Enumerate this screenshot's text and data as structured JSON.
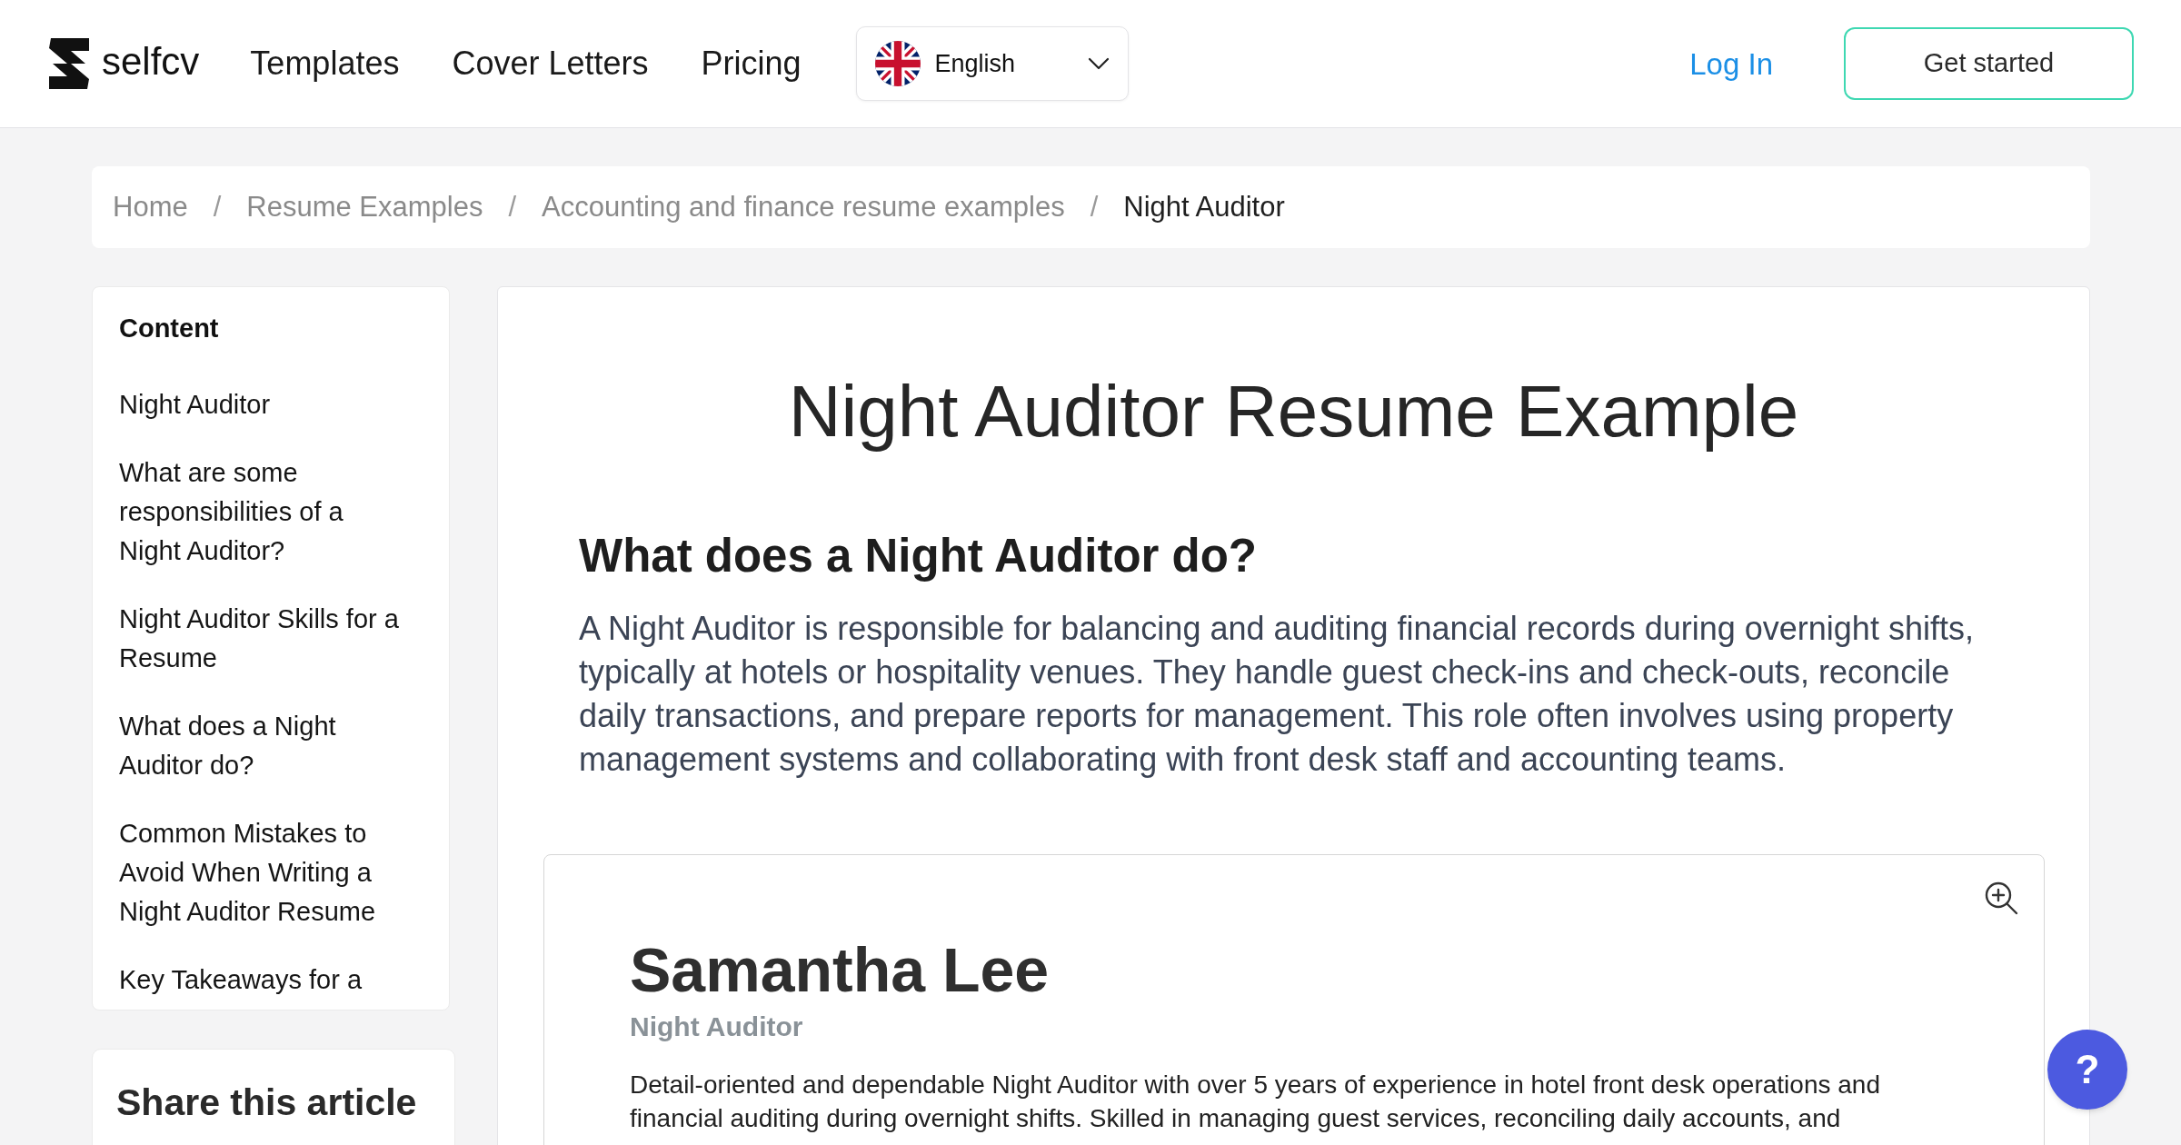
{
  "header": {
    "logo_text": "selfcv",
    "nav": [
      {
        "label": "Templates"
      },
      {
        "label": "Cover Letters"
      },
      {
        "label": "Pricing"
      }
    ],
    "language": {
      "value": "English"
    },
    "login": "Log In",
    "cta": "Get started"
  },
  "breadcrumb": [
    {
      "label": "Home",
      "current": false,
      "separator": "/"
    },
    {
      "label": "Resume Examples",
      "current": false,
      "separator": "/"
    },
    {
      "label": "Accounting and finance resume examples",
      "current": false,
      "separator": "/"
    },
    {
      "label": "Night Auditor",
      "current": true
    }
  ],
  "sidebar": {
    "title": "Content",
    "items": [
      {
        "label": "Night Auditor"
      },
      {
        "label": "What are some responsibilities of a Night Auditor?"
      },
      {
        "label": "Night Auditor Skills for a Resume"
      },
      {
        "label": "What does a Night Auditor do?"
      },
      {
        "label": "Common Mistakes to Avoid When Writing a Night Auditor Resume"
      },
      {
        "label": "Key Takeaways for a"
      }
    ]
  },
  "share": {
    "title": "Share this article"
  },
  "article": {
    "title": "Night Auditor Resume Example",
    "heading": "What does a Night Auditor do?",
    "paragraph": "A Night Auditor is responsible for balancing and auditing financial records during overnight shifts, typically at hotels or hospitality venues. They handle guest check-ins and check-outs, reconcile daily transactions, and prepare reports for management. This role often involves using property management systems and collaborating with front desk staff and accounting teams.",
    "resume_preview": {
      "name": "Samantha Lee",
      "role": "Night Auditor",
      "summary": "Detail-oriented and dependable Night Auditor with over 5 years of experience in hotel front desk operations and financial auditing during overnight shifts. Skilled in managing guest services, reconciling daily accounts, and"
    }
  },
  "help_button": {
    "label": "?"
  }
}
